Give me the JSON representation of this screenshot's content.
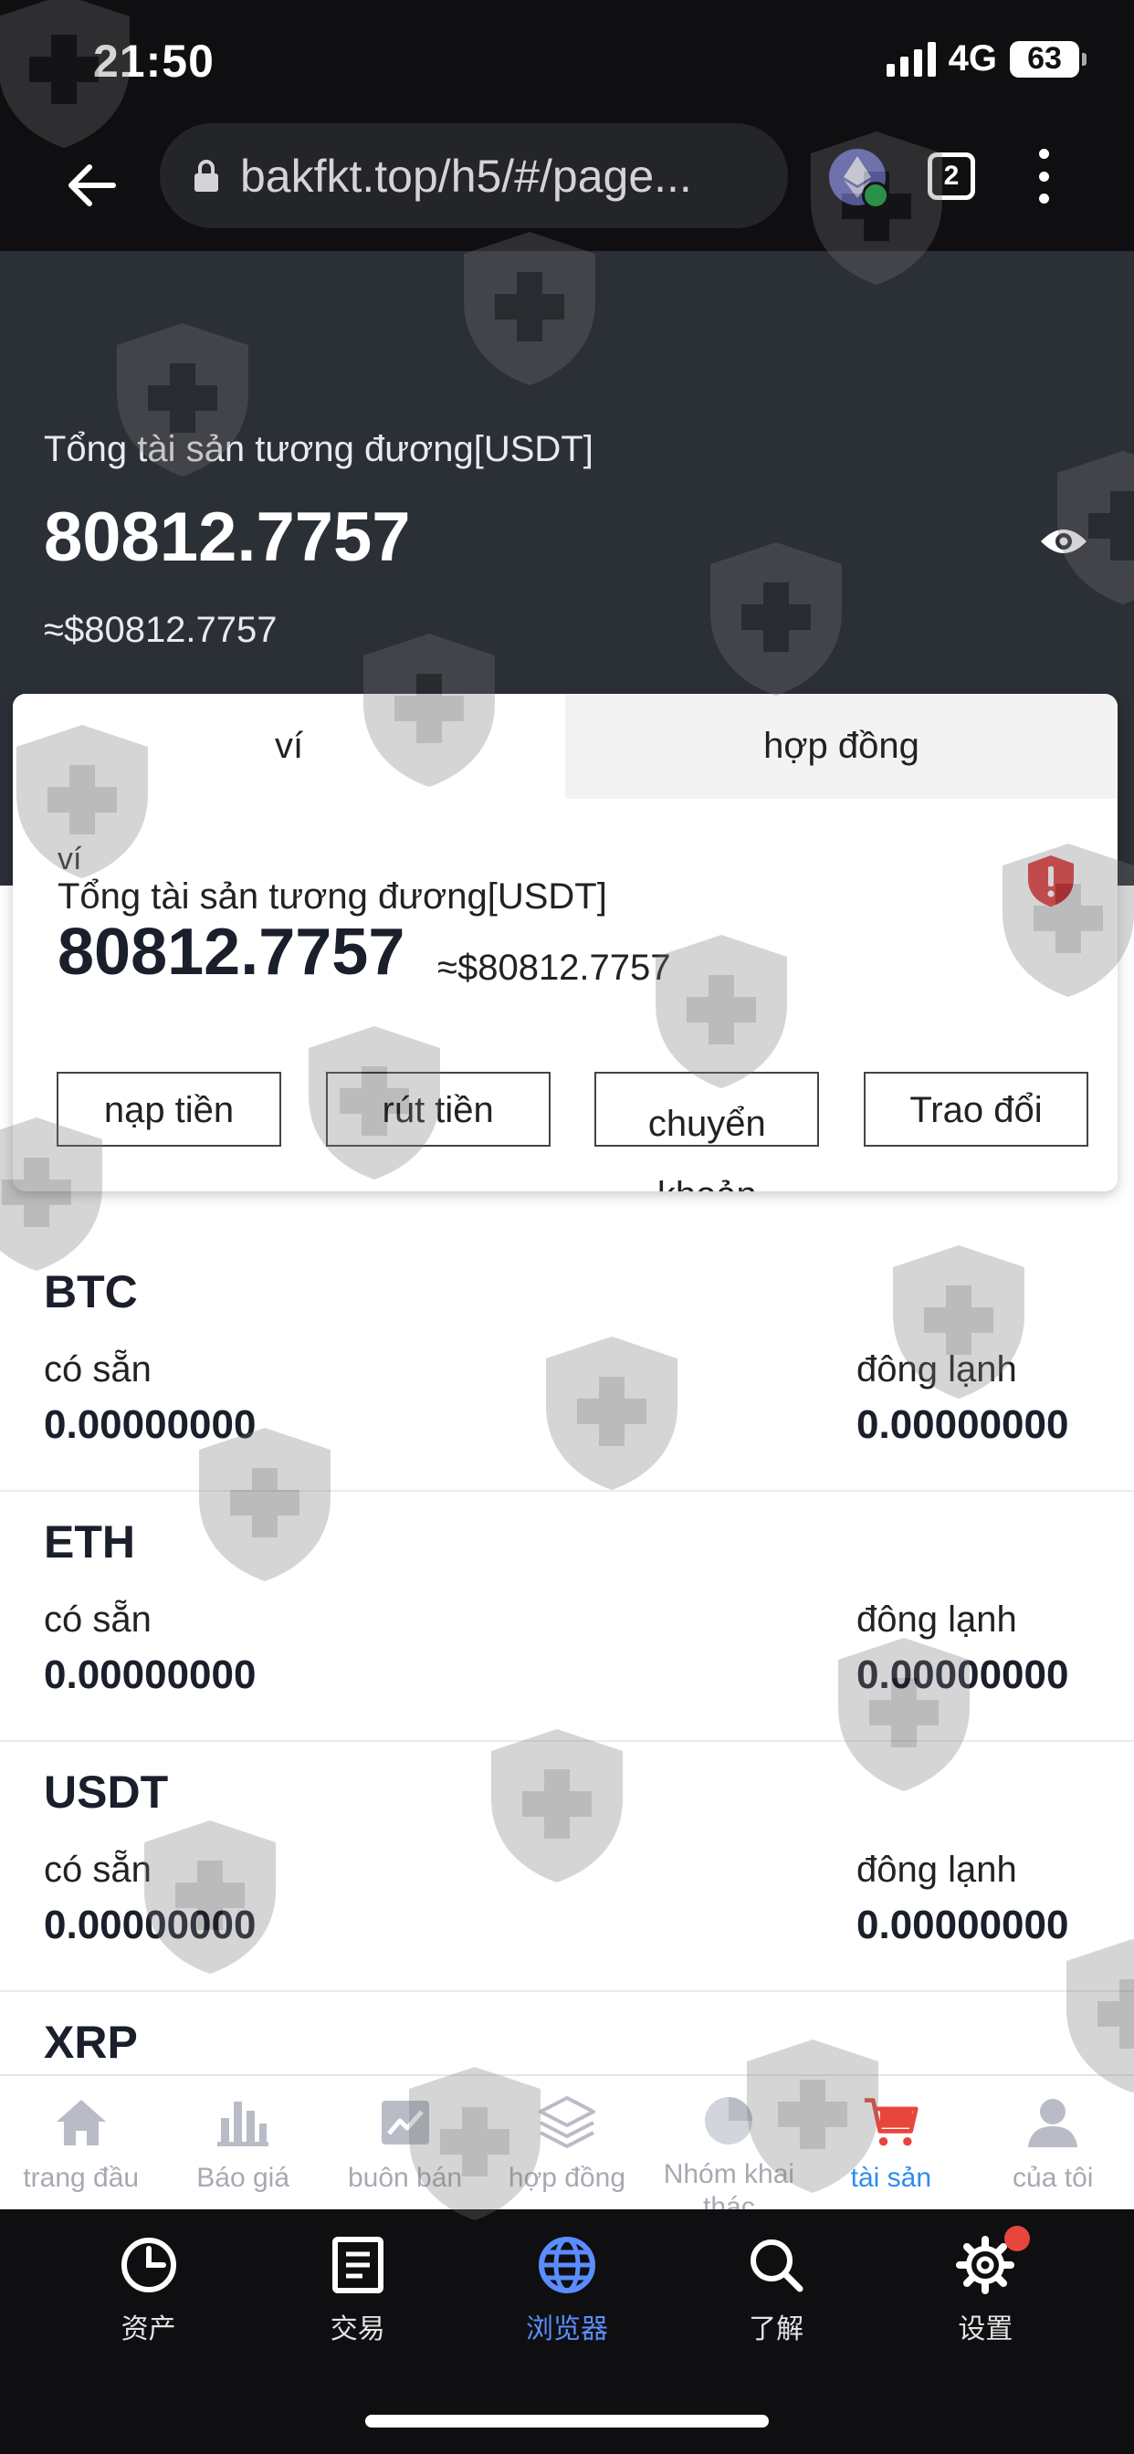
{
  "status_bar": {
    "time": "21:50",
    "network": "4G",
    "battery": "63"
  },
  "browser": {
    "url": "bakfkt.top/h5/#/page...",
    "tab_count": "2"
  },
  "header": {
    "total_label": "Tổng tài sản tương đương[USDT]",
    "total_value": "80812.7757",
    "total_approx": "≈$80812.7757"
  },
  "wallet_card": {
    "tabs": [
      {
        "label": "ví",
        "active": true
      },
      {
        "label": "hợp đồng",
        "active": false
      }
    ],
    "subtitle": "ví",
    "total_label": "Tổng tài sản tương đương[USDT]",
    "total_value": "80812.7757",
    "total_approx": "≈$80812.7757",
    "actions": {
      "deposit": "nạp tiền",
      "withdraw": "rút tiền",
      "transfer": "chuyển khoản",
      "exchange": "Trao đổi"
    }
  },
  "coins": [
    {
      "name": "BTC",
      "available_label": "có sẵn",
      "available": "0.00000000",
      "frozen_label": "đông lạnh",
      "frozen": "0.00000000"
    },
    {
      "name": "ETH",
      "available_label": "có sẵn",
      "available": "0.00000000",
      "frozen_label": "đông lạnh",
      "frozen": "0.00000000"
    },
    {
      "name": "USDT",
      "available_label": "có sẵn",
      "available": "0.00000000",
      "frozen_label": "đông lạnh",
      "frozen": "0.00000000"
    },
    {
      "name": "XRP"
    }
  ],
  "app_nav": [
    {
      "label": "trang đầu",
      "icon": "home-icon",
      "active": false
    },
    {
      "label": "Báo giá",
      "icon": "bar-chart-icon",
      "active": false
    },
    {
      "label": "buôn bán",
      "icon": "trend-chart-icon",
      "active": false
    },
    {
      "label": "hợp đồng",
      "icon": "layers-icon",
      "active": false
    },
    {
      "label": "Nhóm khai thác",
      "icon": "pie-icon",
      "active": false
    },
    {
      "label": "tài sản",
      "icon": "cart-icon",
      "active": true
    },
    {
      "label": "của tôi",
      "icon": "user-icon",
      "active": false
    }
  ],
  "browser_toolbar": [
    {
      "label": "资产",
      "icon": "clock-pie-icon",
      "active": false
    },
    {
      "label": "交易",
      "icon": "document-icon",
      "active": false
    },
    {
      "label": "浏览器",
      "icon": "globe-icon",
      "active": true
    },
    {
      "label": "了解",
      "icon": "search-icon",
      "active": false
    },
    {
      "label": "设置",
      "icon": "gear-icon",
      "active": false
    }
  ],
  "colors": {
    "header_bg": "#2b2f36",
    "accent_blue": "#2d8cf0",
    "cart_red": "#e8453c",
    "toolbar_active": "#5a8dff"
  }
}
